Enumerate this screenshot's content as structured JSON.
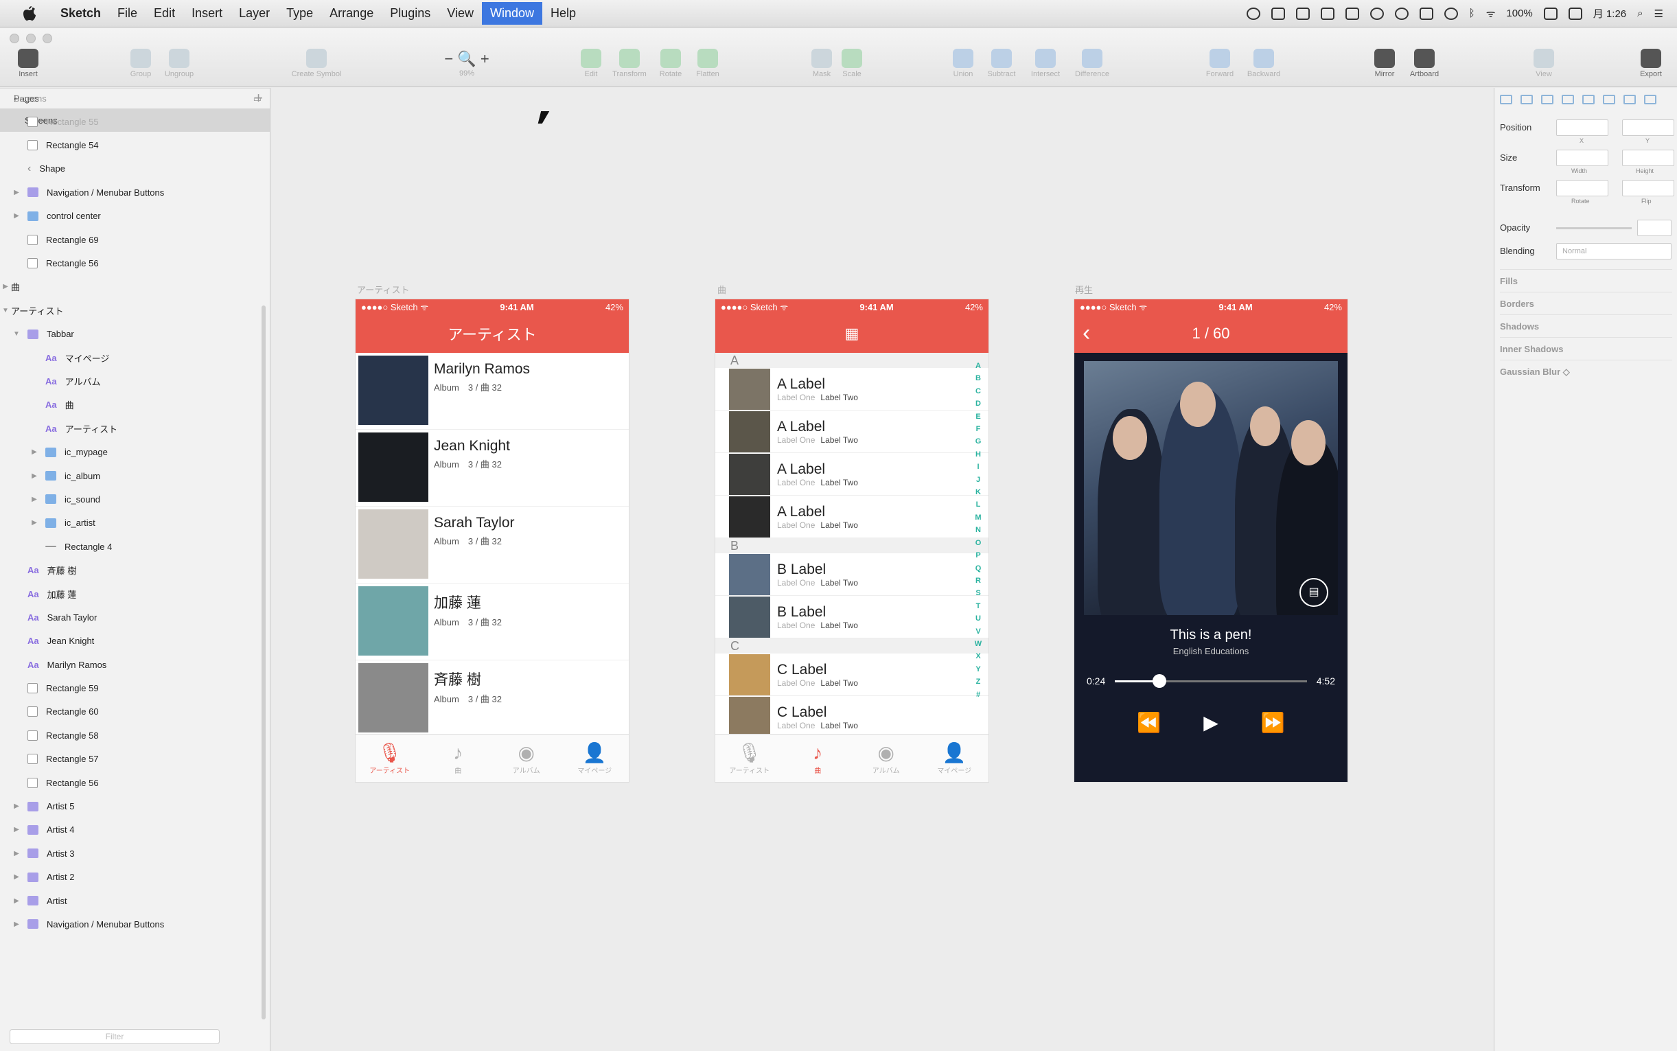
{
  "menubar": {
    "app": "Sketch",
    "items": [
      "File",
      "Edit",
      "Insert",
      "Layer",
      "Type",
      "Arrange",
      "Plugins",
      "View",
      "Window",
      "Help"
    ],
    "selected": "Window",
    "battery": "100%",
    "clock": "月 1:26"
  },
  "toolbar": {
    "zoom_value": "99%",
    "buttons": [
      "Insert",
      "Group",
      "Ungroup",
      "Create Symbol",
      "Edit",
      "Transform",
      "Rotate",
      "Flatten",
      "Mask",
      "Scale",
      "Union",
      "Subtract",
      "Intersect",
      "Difference",
      "Forward",
      "Backward",
      "Mirror",
      "Artboard",
      "View",
      "Export"
    ]
  },
  "pages": {
    "title": "Pages",
    "selected": "Screens"
  },
  "layers": {
    "section": "Screens",
    "rows": [
      {
        "label": "Rectangle 55",
        "icon": "rect",
        "indent": 0,
        "arrow": ""
      },
      {
        "label": "Rectangle 54",
        "icon": "rect",
        "indent": 0,
        "arrow": ""
      },
      {
        "label": "Shape",
        "icon": "shape",
        "indent": 0,
        "arrow": ""
      },
      {
        "label": "Navigation / Menubar Buttons",
        "icon": "folder",
        "indent": 0,
        "arrow": "right"
      },
      {
        "label": "control center",
        "icon": "folderb",
        "indent": 0,
        "arrow": "right"
      },
      {
        "label": "Rectangle 69",
        "icon": "rect",
        "indent": 0,
        "arrow": ""
      },
      {
        "label": "Rectangle 56",
        "icon": "rect",
        "indent": 0,
        "arrow": ""
      },
      {
        "label": "曲",
        "icon": "none",
        "indent": -1,
        "arrow": "right"
      },
      {
        "label": "アーティスト",
        "icon": "none",
        "indent": -1,
        "arrow": "down"
      },
      {
        "label": "Tabbar",
        "icon": "folder",
        "indent": 0,
        "arrow": "down"
      },
      {
        "label": "マイページ",
        "icon": "text",
        "indent": 1,
        "arrow": ""
      },
      {
        "label": "アルバム",
        "icon": "text",
        "indent": 1,
        "arrow": ""
      },
      {
        "label": "曲",
        "icon": "text",
        "indent": 1,
        "arrow": ""
      },
      {
        "label": "アーティスト",
        "icon": "text",
        "indent": 1,
        "arrow": ""
      },
      {
        "label": "ic_mypage",
        "icon": "folderb",
        "indent": 1,
        "arrow": "right"
      },
      {
        "label": "ic_album",
        "icon": "folderb",
        "indent": 1,
        "arrow": "right"
      },
      {
        "label": "ic_sound",
        "icon": "folderb",
        "indent": 1,
        "arrow": "right"
      },
      {
        "label": "ic_artist",
        "icon": "folderb",
        "indent": 1,
        "arrow": "right"
      },
      {
        "label": "Rectangle 4",
        "icon": "line",
        "indent": 1,
        "arrow": ""
      },
      {
        "label": "斉藤 樹",
        "icon": "text",
        "indent": 0,
        "arrow": ""
      },
      {
        "label": "加藤 蓮",
        "icon": "text",
        "indent": 0,
        "arrow": ""
      },
      {
        "label": "Sarah Taylor",
        "icon": "text",
        "indent": 0,
        "arrow": ""
      },
      {
        "label": "Jean Knight",
        "icon": "text",
        "indent": 0,
        "arrow": ""
      },
      {
        "label": "Marilyn Ramos",
        "icon": "text",
        "indent": 0,
        "arrow": ""
      },
      {
        "label": "Rectangle 59",
        "icon": "rect",
        "indent": 0,
        "arrow": ""
      },
      {
        "label": "Rectangle 60",
        "icon": "rect",
        "indent": 0,
        "arrow": ""
      },
      {
        "label": "Rectangle 58",
        "icon": "rect",
        "indent": 0,
        "arrow": ""
      },
      {
        "label": "Rectangle 57",
        "icon": "rect",
        "indent": 0,
        "arrow": ""
      },
      {
        "label": "Rectangle 56",
        "icon": "rect",
        "indent": 0,
        "arrow": ""
      },
      {
        "label": "Artist 5",
        "icon": "folder",
        "indent": 0,
        "arrow": "right"
      },
      {
        "label": "Artist 4",
        "icon": "folder",
        "indent": 0,
        "arrow": "right"
      },
      {
        "label": "Artist 3",
        "icon": "folder",
        "indent": 0,
        "arrow": "right"
      },
      {
        "label": "Artist 2",
        "icon": "folder",
        "indent": 0,
        "arrow": "right"
      },
      {
        "label": "Artist",
        "icon": "folder",
        "indent": 0,
        "arrow": "right"
      },
      {
        "label": "Navigation / Menubar Buttons",
        "icon": "folder",
        "indent": 0,
        "arrow": "right"
      }
    ],
    "filter_placeholder": "Filter"
  },
  "status": {
    "carrier": "●●●●○ Sketch ᯤ",
    "time": "9:41 AM",
    "battery": "42%"
  },
  "artist_screen": {
    "artboard_label": "アーティスト",
    "title": "アーティスト",
    "artists": [
      {
        "name": "Marilyn Ramos",
        "sub": "Album　3 / 曲 32",
        "thumb": "#27344a"
      },
      {
        "name": "Jean Knight",
        "sub": "Album　3 / 曲 32",
        "thumb": "#1a1d22"
      },
      {
        "name": "Sarah Taylor",
        "sub": "Album　3 / 曲 32",
        "thumb": "#cfcac4"
      },
      {
        "name": "加藤 蓮",
        "sub": "Album　3 / 曲 32",
        "thumb": "#6fa6a8"
      },
      {
        "name": "斉藤 樹",
        "sub": "Album　3 / 曲 32",
        "thumb": "#8a8a8a"
      }
    ]
  },
  "song_screen": {
    "artboard_label": "曲",
    "sections": [
      {
        "letter": "A",
        "rows": [
          {
            "label": "A Label",
            "thumb": "#7c7466"
          },
          {
            "label": "A Label",
            "thumb": "#5b564a"
          },
          {
            "label": "A Label",
            "thumb": "#3e3e3c"
          },
          {
            "label": "A Label",
            "thumb": "#2a2a2a"
          }
        ]
      },
      {
        "letter": "B",
        "rows": [
          {
            "label": "B Label",
            "thumb": "#5c6f86"
          },
          {
            "label": "B Label",
            "thumb": "#4d5b66"
          }
        ]
      },
      {
        "letter": "C",
        "rows": [
          {
            "label": "C Label",
            "thumb": "#c59a5a"
          },
          {
            "label": "C Label",
            "thumb": "#8c7a60"
          }
        ]
      }
    ],
    "row_sub1": "Label One",
    "row_sub2": "Label Two",
    "index": [
      "A",
      "B",
      "C",
      "D",
      "E",
      "F",
      "G",
      "H",
      "I",
      "J",
      "K",
      "L",
      "M",
      "N",
      "O",
      "P",
      "Q",
      "R",
      "S",
      "T",
      "U",
      "V",
      "W",
      "X",
      "Y",
      "Z",
      "#"
    ]
  },
  "player_screen": {
    "artboard_label": "再生",
    "title": "1 / 60",
    "song": "This is a pen!",
    "artist": "English Educations",
    "elapsed": "0:24",
    "duration": "4:52",
    "progress": 0.23
  },
  "tabs": [
    {
      "label": "アーティスト",
      "icon": "🎙"
    },
    {
      "label": "曲",
      "icon": "♪"
    },
    {
      "label": "アルバム",
      "icon": "◉"
    },
    {
      "label": "マイページ",
      "icon": "👤"
    }
  ],
  "inspector": {
    "position": "Position",
    "size": "Size",
    "transform": "Transform",
    "opacity": "Opacity",
    "blending": "Blending",
    "blending_value": "Normal",
    "x": "X",
    "y": "Y",
    "width": "Width",
    "height": "Height",
    "rotate": "Rotate",
    "flip": "Flip",
    "sections": [
      "Fills",
      "Borders",
      "Shadows",
      "Inner Shadows",
      "Gaussian Blur ◇"
    ]
  },
  "colors": {
    "accent": "#e9574c",
    "index": "#2bb3a0"
  }
}
